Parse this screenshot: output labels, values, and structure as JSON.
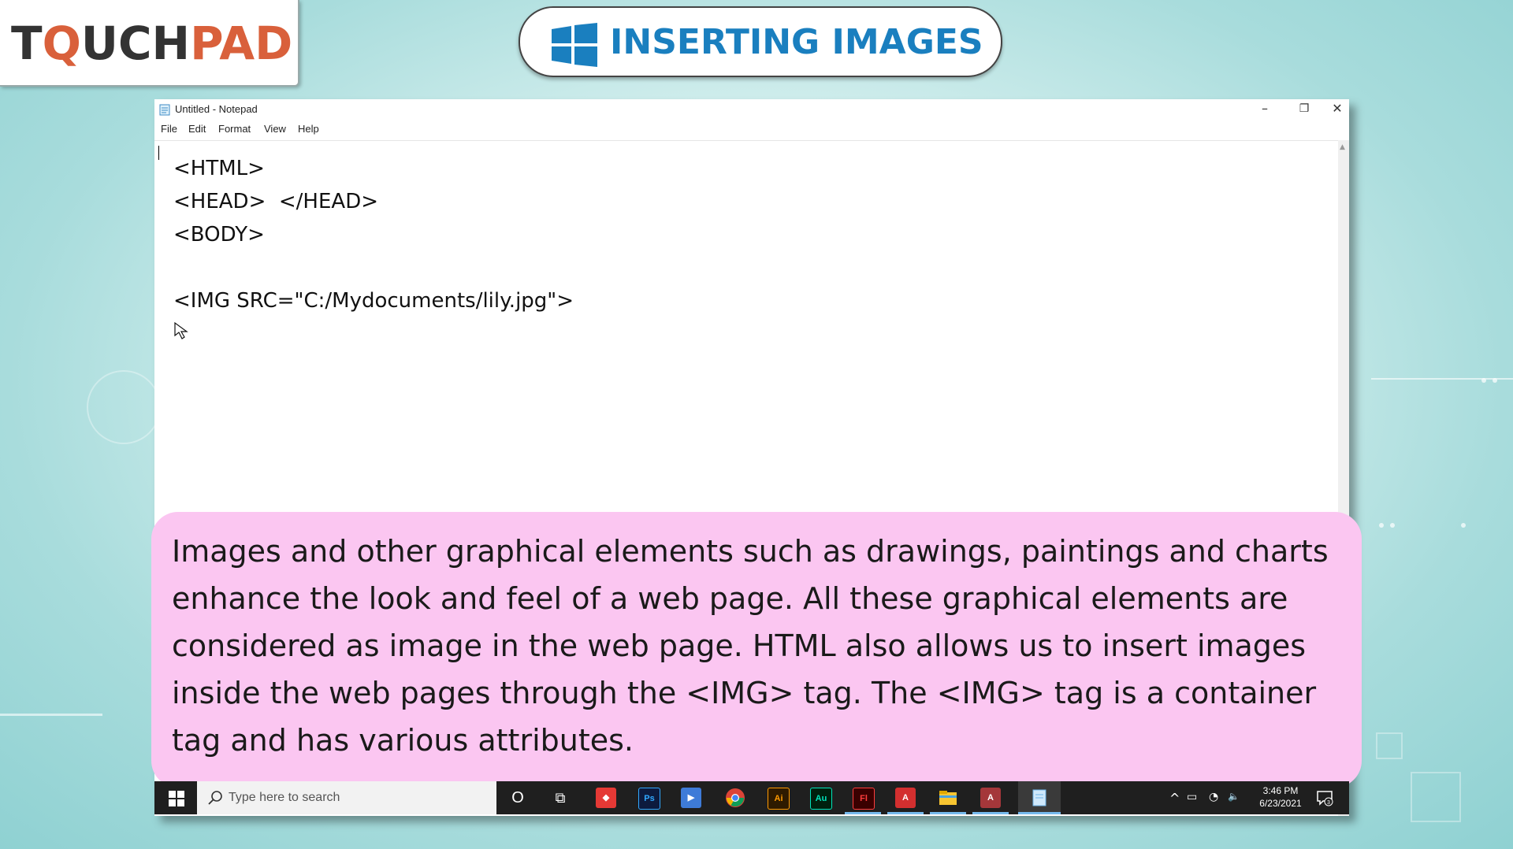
{
  "logo": {
    "part1": "T",
    "part2": "Q",
    "part3": "UCH",
    "part4": "PAD"
  },
  "title": {
    "text": "INSERTING IMAGES"
  },
  "notepad": {
    "window_title": "Untitled - Notepad",
    "minimize": "–",
    "restore": "❐",
    "close": "✕",
    "menu": [
      "File",
      "Edit",
      "Format",
      "View",
      "Help"
    ],
    "lines": [
      "<HTML>",
      "<HEAD>  </HEAD>",
      "<BODY>",
      "",
      "<IMG SRC=\"C:/Mydocuments/lily.jpg\">"
    ]
  },
  "caption": {
    "text": "Images and other graphical elements such as drawings, paintings and charts enhance the look and feel of a web page. All these graphical elements are considered as image in the web page. HTML also allows us to insert images inside the web pages through the <IMG> tag. The <IMG> tag is a container tag and has various attributes."
  },
  "taskbar": {
    "search_placeholder": "Type here to search",
    "apps": [
      {
        "name": "cortana",
        "label": "O"
      },
      {
        "name": "task-view",
        "label": "⧉"
      },
      {
        "name": "anydesk",
        "label": "◆"
      },
      {
        "name": "photoshop",
        "label": "Ps"
      },
      {
        "name": "media-player",
        "label": "▶"
      },
      {
        "name": "chrome",
        "label": ""
      },
      {
        "name": "illustrator",
        "label": "Ai"
      },
      {
        "name": "audition",
        "label": "Au"
      },
      {
        "name": "flash",
        "label": "Fl"
      },
      {
        "name": "acrobat",
        "label": "A"
      },
      {
        "name": "file-explorer",
        "label": ""
      },
      {
        "name": "access",
        "label": "A"
      },
      {
        "name": "notepad",
        "label": ""
      }
    ],
    "tray": {
      "chevron": "^",
      "battery": "▭",
      "wifi": "◔",
      "volume": "🔈"
    },
    "time": "3:46 PM",
    "date": "6/23/2021",
    "notification_count": "3"
  },
  "colors": {
    "title_blue": "#1a7fbf",
    "logo_orange": "#d9603b",
    "caption_pink": "#fbc6f1",
    "taskbar": "#1f1f1f"
  }
}
